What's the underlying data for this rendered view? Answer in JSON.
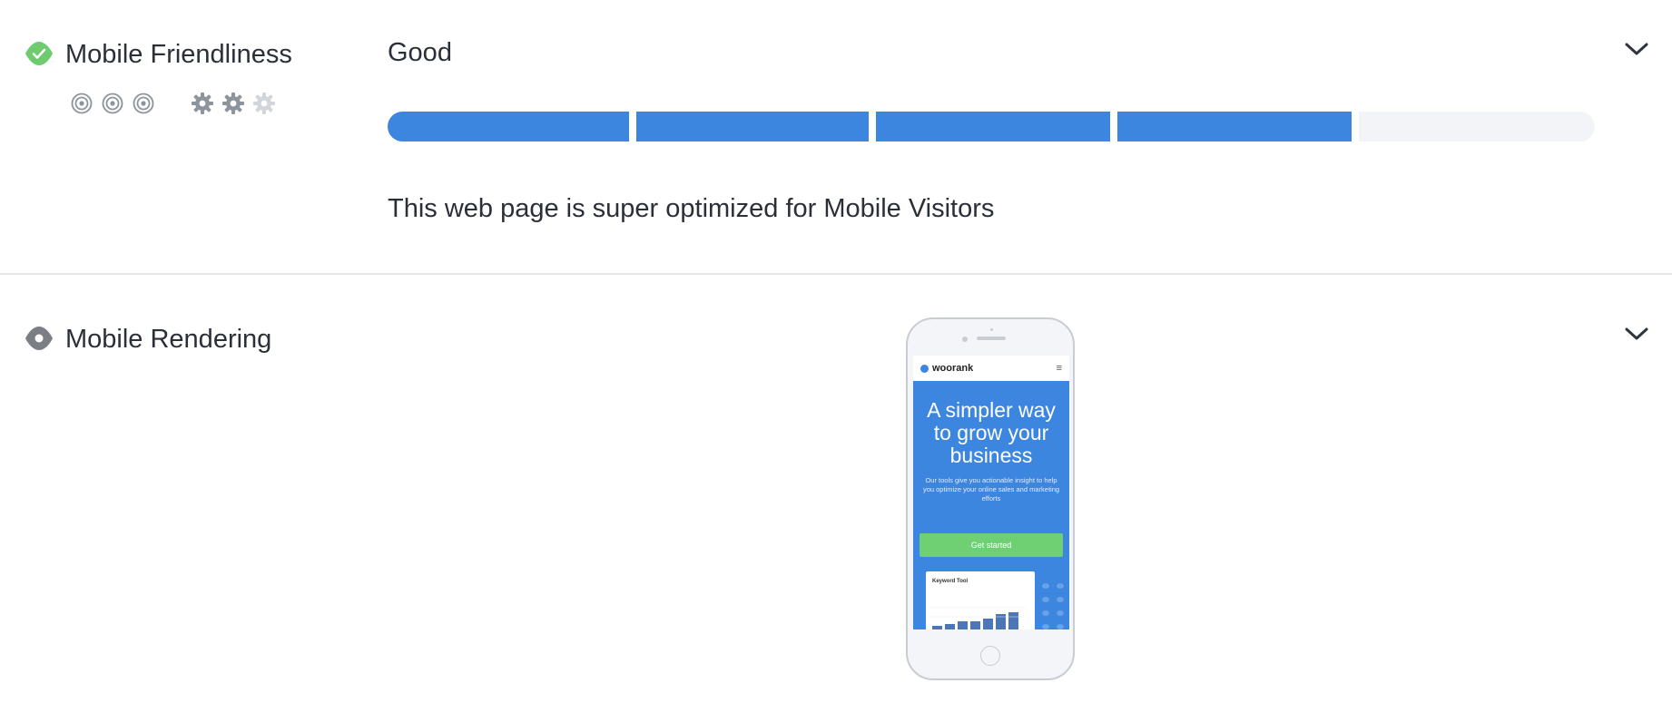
{
  "sections": [
    {
      "title": "Mobile Friendliness",
      "status_icon": "check-icon",
      "status_color": "#6ecb6e",
      "verdict": "Good",
      "score_segments_filled": 4,
      "score_segments_total": 5,
      "description": "This web page is super optimized for Mobile Visitors",
      "impact_icons": [
        "target-icon",
        "target-icon",
        "target-icon"
      ],
      "difficulty_icons": [
        "gear-icon",
        "gear-icon",
        "gear-icon"
      ],
      "difficulty_level_filled": 2
    },
    {
      "title": "Mobile Rendering",
      "status_icon": "info-dot-icon",
      "status_color": "#7b7f85",
      "phone_preview": {
        "brand": "woorank",
        "menu_glyph": "≡",
        "headline": "A simpler way to grow your business",
        "subtext": "Our tools give you actionable insight to help you optimize your online sales and marketing efforts",
        "cta": "Get started",
        "card_title": "Keyword Tool"
      }
    }
  ],
  "colors": {
    "accent_blue": "#3d86e0",
    "empty_segment": "#f3f4f8",
    "success_green": "#6ecb6e",
    "cta_green": "#6fcf73"
  }
}
